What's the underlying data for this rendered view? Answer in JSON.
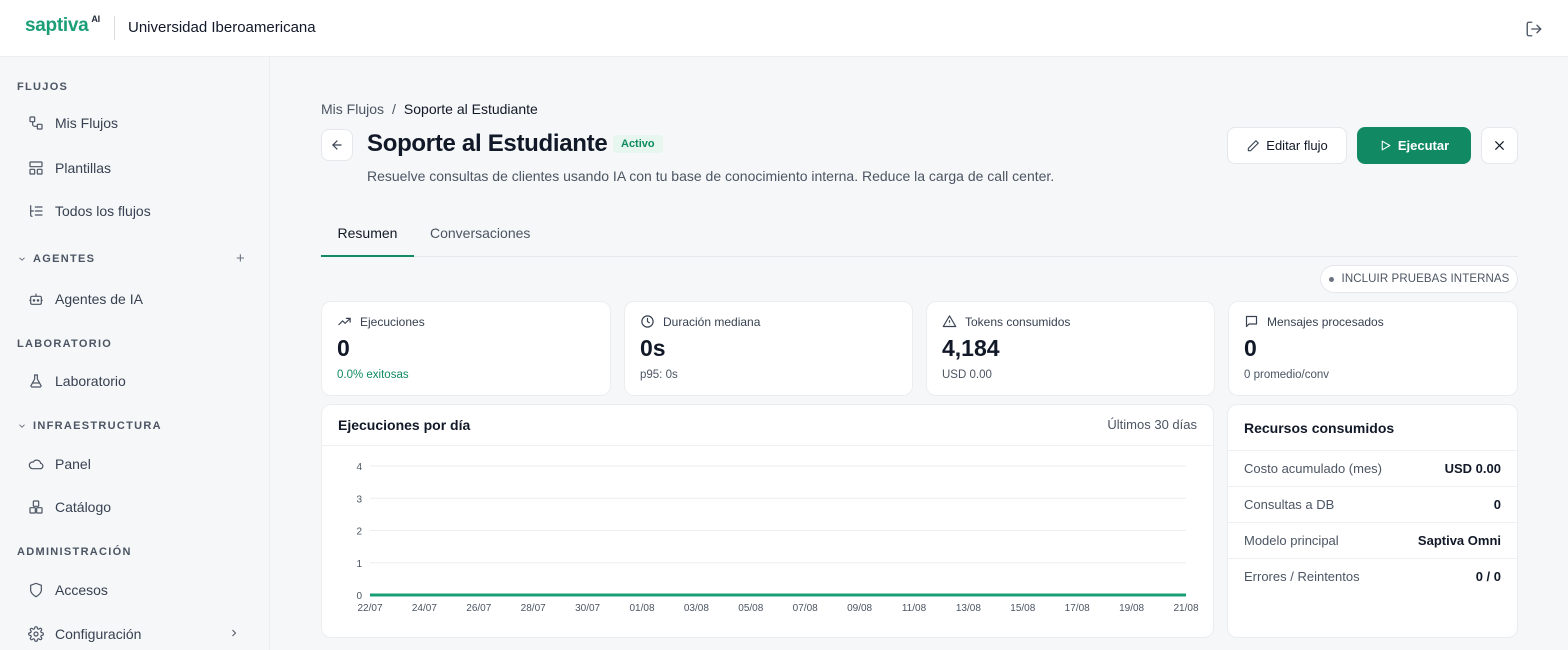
{
  "brand": {
    "logo_text": "saptiva",
    "logo_sup": "AI",
    "org_name": "Universidad Iberoamericana",
    "accent": "#118a63"
  },
  "sidebar": {
    "sections": {
      "flujos": "FLUJOS",
      "agentes": "AGENTES",
      "laboratorio": "LABORATORIO",
      "infraestructura": "INFRAESTRUCTURA",
      "administracion": "ADMINISTRACIÓN"
    },
    "items": {
      "mis_flujos": "Mis Flujos",
      "plantillas": "Plantillas",
      "todos_flujos": "Todos los flujos",
      "agentes_ia": "Agentes de IA",
      "laboratorio": "Laboratorio",
      "panel": "Panel",
      "catalogo": "Catálogo",
      "accesos": "Accesos",
      "configuracion": "Configuración"
    }
  },
  "breadcrumb": {
    "parent": "Mis Flujos",
    "separator": "/",
    "current": "Soporte al Estudiante"
  },
  "header": {
    "title": "Soporte al Estudiante",
    "status": "Activo",
    "subtitle": "Resuelve consultas de clientes usando IA con tu base de conocimiento interna. Reduce la carga de call center.",
    "edit_label": "Editar flujo",
    "run_label": "Ejecutar"
  },
  "tabs": {
    "resumen": "Resumen",
    "conversaciones": "Conversaciones"
  },
  "toggle_label": "INCLUIR PRUEBAS INTERNAS",
  "metrics": [
    {
      "label": "Ejecuciones",
      "value": "0",
      "sub": "0.0% exitosas",
      "icon": "trending-up-icon"
    },
    {
      "label": "Duración mediana",
      "value": "0s",
      "sub": "p95: 0s",
      "icon": "clock-icon"
    },
    {
      "label": "Tokens consumidos",
      "value": "4,184",
      "sub": "USD 0.00",
      "icon": "alert-triangle-icon"
    },
    {
      "label": "Mensajes procesados",
      "value": "0",
      "sub": "0 promedio/conv",
      "icon": "message-icon"
    }
  ],
  "chart_panel": {
    "title": "Ejecuciones por día",
    "range": "Últimos 30 días"
  },
  "chart_data": {
    "type": "area",
    "title": "Ejecuciones por día",
    "x": [
      "22/07",
      "23/07",
      "24/07",
      "25/07",
      "26/07",
      "27/07",
      "28/07",
      "29/07",
      "30/07",
      "31/07",
      "01/08",
      "02/08",
      "03/08",
      "04/08",
      "05/08",
      "06/08",
      "07/08",
      "08/08",
      "09/08",
      "10/08",
      "11/08",
      "12/08",
      "13/08",
      "14/08",
      "15/08",
      "16/08",
      "17/08",
      "18/08",
      "19/08",
      "20/08",
      "21/08"
    ],
    "xticks": [
      "22/07",
      "24/07",
      "26/07",
      "28/07",
      "30/07",
      "01/08",
      "03/08",
      "05/08",
      "07/08",
      "09/08",
      "11/08",
      "13/08",
      "15/08",
      "17/08",
      "19/08",
      "21/08"
    ],
    "values": [
      0,
      0,
      0,
      0,
      0,
      0,
      0,
      0,
      0,
      0,
      0,
      0,
      0,
      0,
      0,
      0,
      0,
      0,
      0,
      0,
      0,
      0,
      0,
      0,
      0,
      0,
      0,
      0,
      0,
      0,
      0
    ],
    "yticks": [
      0,
      1,
      2,
      3,
      4
    ],
    "ylim": [
      0,
      4
    ],
    "grid": true,
    "color": "#1a9e76"
  },
  "resources": {
    "title": "Recursos consumidos",
    "rows": [
      {
        "label": "Costo acumulado (mes)",
        "value": "USD 0.00"
      },
      {
        "label": "Consultas a DB",
        "value": "0"
      },
      {
        "label": "Modelo principal",
        "value": "Saptiva Omni"
      },
      {
        "label": "Errores / Reintentos",
        "value": "0 / 0"
      }
    ]
  }
}
